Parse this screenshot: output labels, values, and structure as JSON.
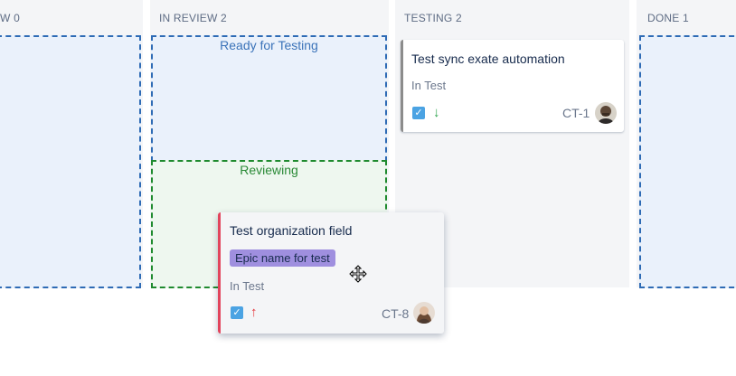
{
  "columns": [
    {
      "title": "W",
      "count": "0"
    },
    {
      "title": "IN REVIEW",
      "count": "2"
    },
    {
      "title": "TESTING",
      "count": "2"
    },
    {
      "title": "DONE",
      "count": "1"
    }
  ],
  "zones": {
    "ready": "Ready for Testing",
    "reviewing": "Reviewing"
  },
  "cards": {
    "sync": {
      "title": "Test sync exate automation",
      "status": "In Test",
      "key": "CT-1",
      "bar_color": "#8c8c8c",
      "priority_color": "#2da44e"
    },
    "org": {
      "title": "Test organization field",
      "epic": "Epic name for test",
      "status": "In Test",
      "key": "CT-8",
      "bar_color": "#e2445c",
      "priority_color": "#e5343a"
    }
  },
  "icons": {
    "check": "check-icon",
    "priority_low": "arrow-down-icon",
    "priority_high": "arrow-up-icon",
    "cursor": "move-cursor-icon"
  },
  "colors": {
    "column_bg": "#f4f5f7",
    "drop_blue": "#2e6bb5",
    "drop_green": "#1f8a2e",
    "epic_bg": "#9f8fdf"
  }
}
